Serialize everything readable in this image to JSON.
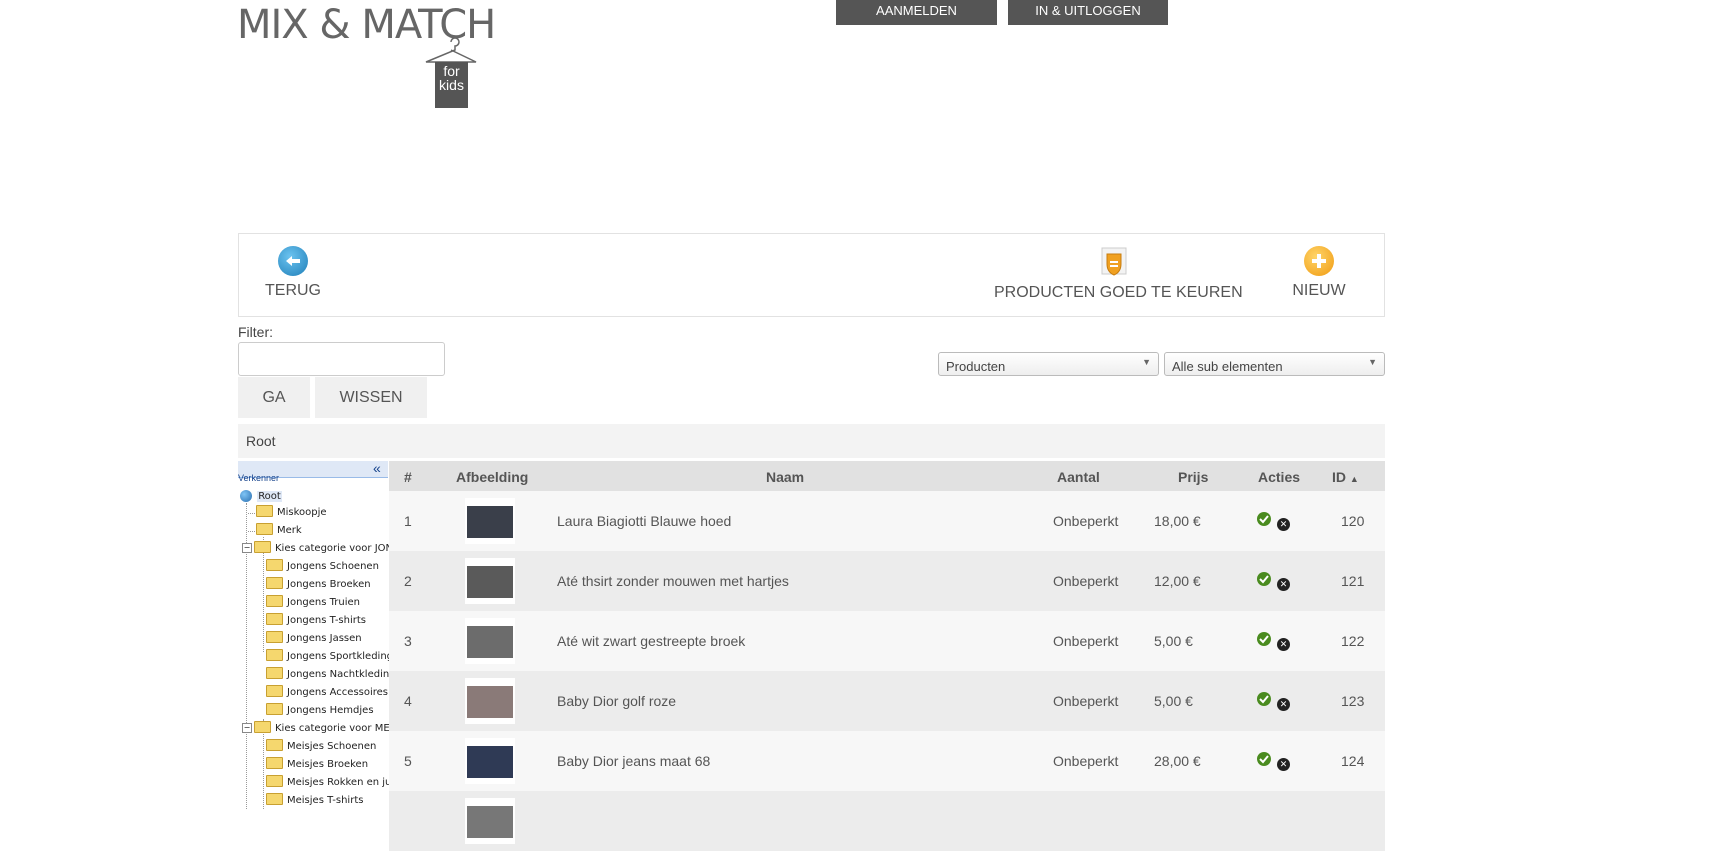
{
  "logo": {
    "title": "MIX & MATCH",
    "tag_line1": "for",
    "tag_line2": "kids"
  },
  "top_nav": {
    "signup": "AANMELDEN",
    "login": "IN & UITLOGGEN"
  },
  "toolbar": {
    "back": "TERUG",
    "approve": "PRODUCTEN GOED TE KEUREN",
    "new": "NIEUW"
  },
  "filter": {
    "label": "Filter:",
    "value": "",
    "go": "GA",
    "clear": "WISSEN"
  },
  "selects": {
    "type": "Producten",
    "sub": "Alle sub elementen"
  },
  "breadcrumb": "Root",
  "tree": {
    "title": "Verkenner",
    "collapse": "«",
    "root": "Root",
    "nodes": [
      "Miskoopje",
      "Merk",
      "Kies categorie voor JONGENS",
      "Jongens Schoenen",
      "Jongens Broeken",
      "Jongens Truien",
      "Jongens T-shirts",
      "Jongens Jassen",
      "Jongens Sportkleding",
      "Jongens Nachtkleding",
      "Jongens Accessoires",
      "Jongens Hemdjes",
      "Kies categorie voor MEISJES",
      "Meisjes Schoenen",
      "Meisjes Broeken",
      "Meisjes Rokken en jurken",
      "Meisjes T-shirts"
    ]
  },
  "table": {
    "headers": {
      "num": "#",
      "image": "Afbeelding",
      "name": "Naam",
      "qty": "Aantal",
      "price": "Prijs",
      "actions": "Acties",
      "id": "ID",
      "sort_icon": "▲"
    },
    "rows": [
      {
        "num": "1",
        "name": "Laura Biagiotti Blauwe hoed",
        "qty": "Onbeperkt",
        "price": "18,00 €",
        "id": "120",
        "thumb_color": "#3a3f4a"
      },
      {
        "num": "2",
        "name": "Até thsirt zonder mouwen met hartjes",
        "qty": "Onbeperkt",
        "price": "12,00 €",
        "id": "121",
        "thumb_color": "#5a5a5a"
      },
      {
        "num": "3",
        "name": "Até wit zwart gestreepte broek",
        "qty": "Onbeperkt",
        "price": "5,00 €",
        "id": "122",
        "thumb_color": "#6c6c6c"
      },
      {
        "num": "4",
        "name": "Baby Dior golf roze",
        "qty": "Onbeperkt",
        "price": "5,00 €",
        "id": "123",
        "thumb_color": "#8a7a78"
      },
      {
        "num": "5",
        "name": "Baby Dior jeans maat 68",
        "qty": "Onbeperkt",
        "price": "28,00 €",
        "id": "124",
        "thumb_color": "#2f3a55"
      },
      {
        "num": "",
        "name": "",
        "qty": "",
        "price": "",
        "id": "",
        "thumb_color": "#777777"
      }
    ]
  },
  "colors": {
    "dark_button": "#555555",
    "back_icon": "#2a8fc7",
    "add_icon": "#f5a623",
    "approve_icon": "#f0a020",
    "ok_icon": "#4a8b1f"
  }
}
